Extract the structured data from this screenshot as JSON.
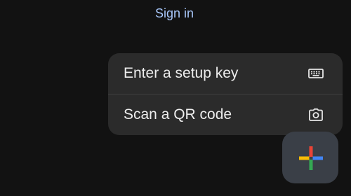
{
  "header": {
    "sign_in_label": "Sign in"
  },
  "menu": {
    "items": [
      {
        "label": "Enter a setup key",
        "icon": "keyboard-icon"
      },
      {
        "label": "Scan a QR code",
        "icon": "camera-icon"
      }
    ]
  },
  "fab": {
    "icon": "google-plus-icon",
    "colors": {
      "red": "#ea4335",
      "blue": "#4285f4",
      "green": "#34a853",
      "yellow": "#fbbc05"
    }
  },
  "theme": {
    "background": "#121212",
    "menu_background": "#2b2b2b",
    "link_color": "#a8c7fa",
    "fab_background": "#3a3f47"
  }
}
